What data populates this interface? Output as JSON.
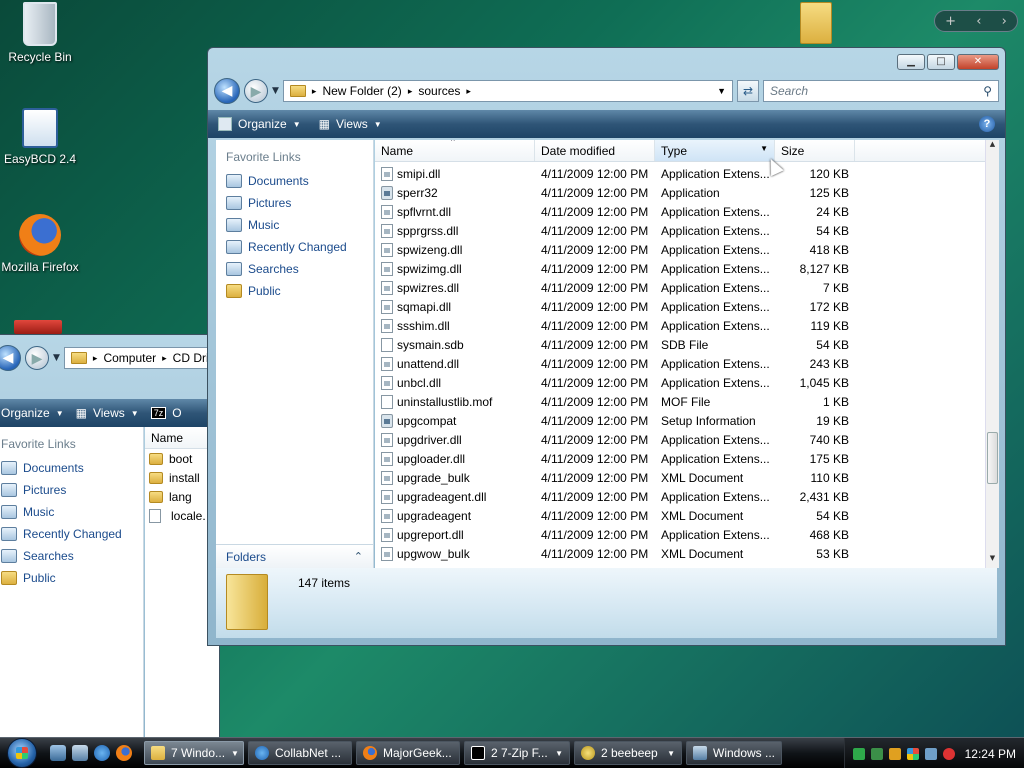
{
  "desktop": {
    "icons": [
      {
        "label": "Recycle Bin",
        "icon": "recycle-bin-icon"
      },
      {
        "label": "EasyBCD 2.4",
        "icon": "easybcd-icon"
      },
      {
        "label": "Mozilla Firefox",
        "icon": "firefox-icon"
      }
    ]
  },
  "window_back": {
    "breadcrumb": [
      "Computer",
      "CD Dri"
    ],
    "cmd": {
      "organize": "Organize",
      "views": "Views",
      "sevenzip": "O"
    },
    "favorite_links_title": "Favorite Links",
    "links": [
      "Documents",
      "Pictures",
      "Music",
      "Recently Changed",
      "Searches",
      "Public"
    ],
    "column_name": "Name",
    "files": [
      "boot",
      "install",
      "lang",
      "locale."
    ]
  },
  "window_front": {
    "breadcrumb": [
      "New Folder (2)",
      "sources"
    ],
    "search_placeholder": "Search",
    "cmd": {
      "organize": "Organize",
      "views": "Views"
    },
    "favorite_links_title": "Favorite Links",
    "links": [
      "Documents",
      "Pictures",
      "Music",
      "Recently Changed",
      "Searches",
      "Public"
    ],
    "folders_label": "Folders",
    "columns": {
      "name": "Name",
      "date": "Date modified",
      "type": "Type",
      "size": "Size"
    },
    "files": [
      {
        "name": "smipi.dll",
        "date": "4/11/2009 12:00 PM",
        "type": "Application Extens...",
        "size": "120 KB",
        "icon": "dll-icon"
      },
      {
        "name": "sperr32",
        "date": "4/11/2009 12:00 PM",
        "type": "Application",
        "size": "125 KB",
        "icon": "application-icon"
      },
      {
        "name": "spflvrnt.dll",
        "date": "4/11/2009 12:00 PM",
        "type": "Application Extens...",
        "size": "24 KB",
        "icon": "dll-icon"
      },
      {
        "name": "spprgrss.dll",
        "date": "4/11/2009 12:00 PM",
        "type": "Application Extens...",
        "size": "54 KB",
        "icon": "dll-icon"
      },
      {
        "name": "spwizeng.dll",
        "date": "4/11/2009 12:00 PM",
        "type": "Application Extens...",
        "size": "418 KB",
        "icon": "dll-icon"
      },
      {
        "name": "spwizimg.dll",
        "date": "4/11/2009 12:00 PM",
        "type": "Application Extens...",
        "size": "8,127 KB",
        "icon": "dll-icon"
      },
      {
        "name": "spwizres.dll",
        "date": "4/11/2009 12:00 PM",
        "type": "Application Extens...",
        "size": "7 KB",
        "icon": "dll-icon"
      },
      {
        "name": "sqmapi.dll",
        "date": "4/11/2009 12:00 PM",
        "type": "Application Extens...",
        "size": "172 KB",
        "icon": "dll-icon"
      },
      {
        "name": "ssshim.dll",
        "date": "4/11/2009 12:00 PM",
        "type": "Application Extens...",
        "size": "119 KB",
        "icon": "dll-icon"
      },
      {
        "name": "sysmain.sdb",
        "date": "4/11/2009 12:00 PM",
        "type": "SDB File",
        "size": "54 KB",
        "icon": "file-icon"
      },
      {
        "name": "unattend.dll",
        "date": "4/11/2009 12:00 PM",
        "type": "Application Extens...",
        "size": "243 KB",
        "icon": "dll-icon"
      },
      {
        "name": "unbcl.dll",
        "date": "4/11/2009 12:00 PM",
        "type": "Application Extens...",
        "size": "1,045 KB",
        "icon": "dll-icon"
      },
      {
        "name": "uninstallustlib.mof",
        "date": "4/11/2009 12:00 PM",
        "type": "MOF File",
        "size": "1 KB",
        "icon": "file-icon"
      },
      {
        "name": "upgcompat",
        "date": "4/11/2009 12:00 PM",
        "type": "Setup Information",
        "size": "19 KB",
        "icon": "setup-icon"
      },
      {
        "name": "upgdriver.dll",
        "date": "4/11/2009 12:00 PM",
        "type": "Application Extens...",
        "size": "740 KB",
        "icon": "dll-icon"
      },
      {
        "name": "upgloader.dll",
        "date": "4/11/2009 12:00 PM",
        "type": "Application Extens...",
        "size": "175 KB",
        "icon": "dll-icon"
      },
      {
        "name": "upgrade_bulk",
        "date": "4/11/2009 12:00 PM",
        "type": "XML Document",
        "size": "110 KB",
        "icon": "xml-icon"
      },
      {
        "name": "upgradeagent.dll",
        "date": "4/11/2009 12:00 PM",
        "type": "Application Extens...",
        "size": "2,431 KB",
        "icon": "dll-icon"
      },
      {
        "name": "upgradeagent",
        "date": "4/11/2009 12:00 PM",
        "type": "XML Document",
        "size": "54 KB",
        "icon": "xml-icon"
      },
      {
        "name": "upgreport.dll",
        "date": "4/11/2009 12:00 PM",
        "type": "Application Extens...",
        "size": "468 KB",
        "icon": "dll-icon"
      },
      {
        "name": "upgwow_bulk",
        "date": "4/11/2009 12:00 PM",
        "type": "XML Document",
        "size": "53 KB",
        "icon": "xml-icon"
      }
    ],
    "item_count": "147 items"
  },
  "taskbar": {
    "tasks": [
      {
        "label": "7 Windo...",
        "icon": "folder-icon",
        "active": true
      },
      {
        "label": "CollabNet ...",
        "icon": "ie-icon"
      },
      {
        "label": "MajorGeek...",
        "icon": "firefox-icon"
      },
      {
        "label": "2 7-Zip F...",
        "icon": "sevenzip-icon"
      },
      {
        "label": "2 beebeep",
        "icon": "beebeep-icon"
      },
      {
        "label": "Windows ...",
        "icon": "windows-icon"
      }
    ],
    "clock": "12:24 PM"
  },
  "colors": {
    "accent": "#1b4b8c",
    "command_bar": "#2f5577",
    "title_glass": "#b7d6e6"
  }
}
